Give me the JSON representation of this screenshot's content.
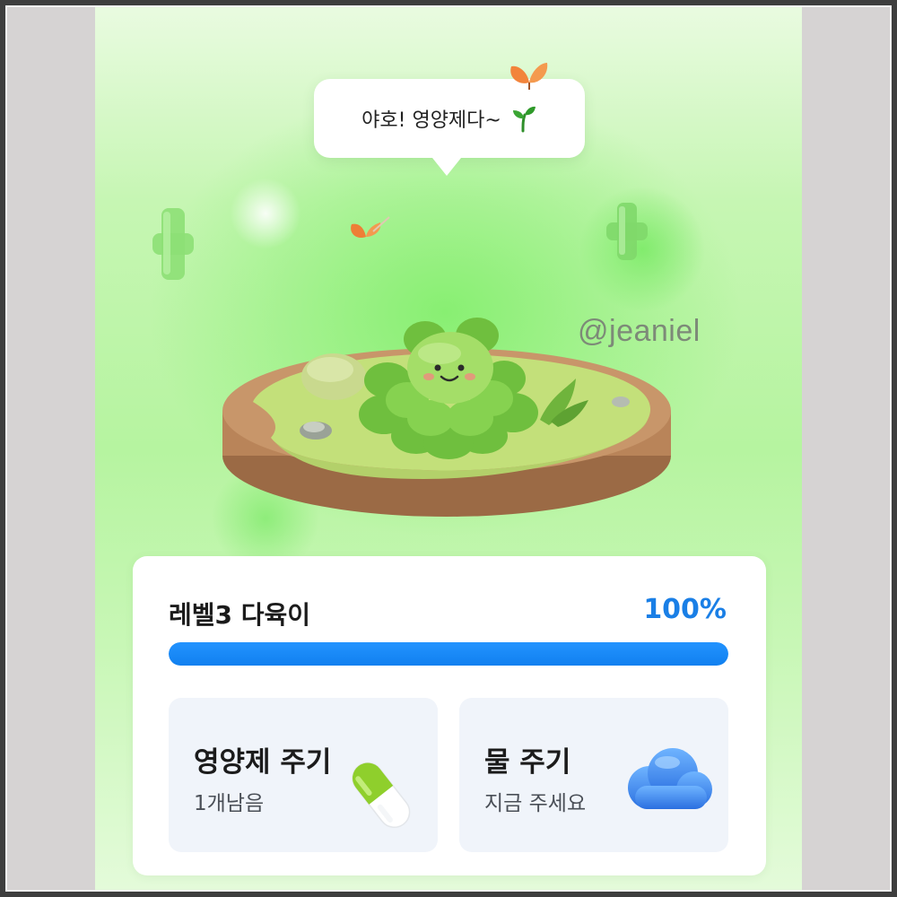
{
  "bubble": {
    "text": "야호! 영양제다~",
    "icon": "sprout-icon"
  },
  "watermark": "@jeaniel",
  "status": {
    "title": "레벨3 다육이",
    "percent_label": "100%",
    "progress": 1.0
  },
  "actions": [
    {
      "title": "영양제 주기",
      "subtitle": "1개남음",
      "icon": "pill-icon"
    },
    {
      "title": "물 주기",
      "subtitle": "지금 주세요",
      "icon": "cloud-icon"
    }
  ],
  "colors": {
    "accent": "#1a7fe6",
    "progress": "#1180ef",
    "background": "#b6f4a0",
    "plant": "#7dc74a"
  }
}
